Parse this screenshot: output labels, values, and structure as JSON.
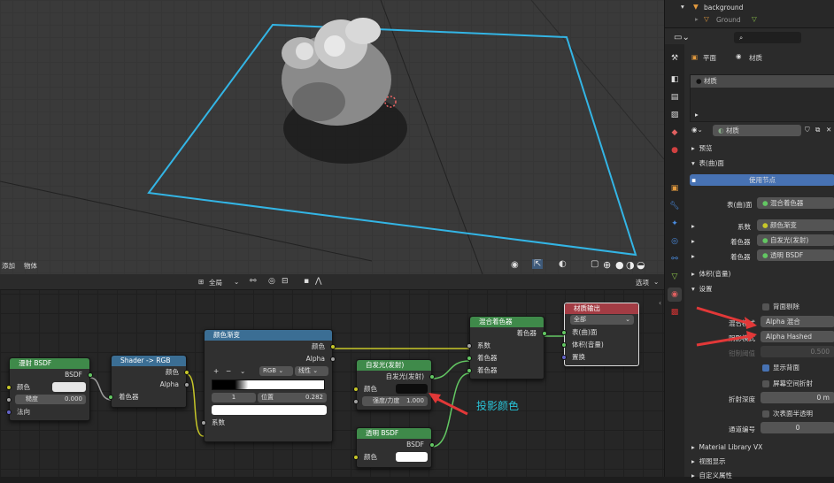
{
  "viewport": {
    "add_menu": "添加",
    "object_menu": "物体"
  },
  "node_header": {
    "global": "全局",
    "options": "选项"
  },
  "nodes": {
    "diffuse": {
      "title": "漫射 BSDF",
      "out": "BSDF",
      "color": "颜色",
      "roughness": "糙度",
      "roughness_val": "0.000",
      "normal": "法向"
    },
    "shader_rgb": {
      "title": "Shader -> RGB",
      "color": "颜色",
      "alpha": "Alpha",
      "shader": "着色器"
    },
    "ramp": {
      "title": "颜色渐变",
      "color": "颜色",
      "alpha": "Alpha",
      "mode": "RGB",
      "interp": "线性",
      "index": "1",
      "pos_label": "位置",
      "pos_val": "0.282",
      "fac": "系数"
    },
    "emission": {
      "title": "自发光(发射)",
      "out": "自发光(发射)",
      "color": "颜色",
      "strength": "强度/力度",
      "strength_val": "1.000"
    },
    "transparent": {
      "title": "透明 BSDF",
      "out": "BSDF",
      "color": "颜色"
    },
    "mix": {
      "title": "混合着色器",
      "out": "着色器",
      "fac": "系数",
      "s1": "着色器",
      "s2": "着色器"
    },
    "output": {
      "title": "材质输出",
      "target": "全部",
      "surface": "表(曲)面",
      "volume": "体积(音量)",
      "disp": "置换"
    }
  },
  "annotation": "投影颜色",
  "outliner": {
    "item1": "background",
    "item2": "Ground"
  },
  "props": {
    "plane": "平面",
    "material": "材质",
    "slot": "材质",
    "mat_name": "材质",
    "preview": "预览",
    "surface": "表(曲)面",
    "use_nodes": "使用节点",
    "surface_label": "表(曲)面",
    "surface_val": "混合着色器",
    "fac_label": "系数",
    "fac_val": "颜色渐变",
    "shader1_label": "着色器",
    "shader1_val": "自发光(发射)",
    "shader2_label": "着色器",
    "shader2_val": "透明 BSDF",
    "volume": "体积(音量)",
    "settings": "设置",
    "backface": "背面剔除",
    "blend_label": "混合模式",
    "blend_val": "Alpha 混合",
    "shadow_label": "阴影模式",
    "shadow_val": "Alpha Hashed",
    "clip_label": "钳制阈值",
    "clip_val": "0.500",
    "show_back": "显示背面",
    "ssr": "屏幕空间折射",
    "refr_depth": "折射深度",
    "refr_val": "0 m",
    "sss": "次表面半透明",
    "pass_idx": "通道编号",
    "pass_val": "0",
    "mat_lib": "Material Library VX",
    "viewport_display": "视图显示",
    "custom_props": "自定义属性"
  },
  "colors": {
    "accent": "#4772b3",
    "red_arrow": "#e23838",
    "annotation": "#29c2d6",
    "selection": "#33b5e5"
  }
}
